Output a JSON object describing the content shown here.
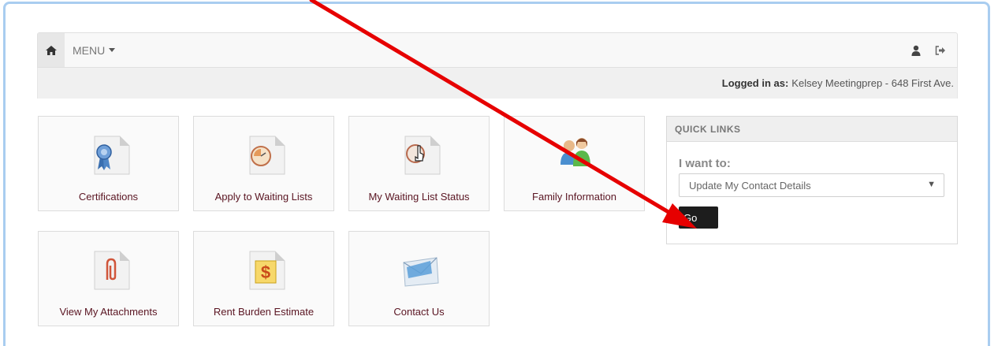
{
  "navbar": {
    "home_icon": "home-icon",
    "menu_label": "MENU",
    "user_icon": "user-icon",
    "logout_icon": "logout-icon"
  },
  "login": {
    "prefix": "Logged in as:",
    "name": "Kelsey Meetingprep - 648 First Ave."
  },
  "tiles": [
    {
      "label": "Certifications",
      "icon": "award-ribbon-icon"
    },
    {
      "label": "Apply to Waiting Lists",
      "icon": "clock-icon"
    },
    {
      "label": "My Waiting List Status",
      "icon": "status-clock-icon"
    },
    {
      "label": "Family Information",
      "icon": "family-icon"
    },
    {
      "label": "View My Attachments",
      "icon": "paperclip-icon"
    },
    {
      "label": "Rent Burden Estimate",
      "icon": "dollar-icon"
    },
    {
      "label": "Contact Us",
      "icon": "envelope-icon"
    }
  ],
  "quick_links": {
    "title": "QUICK LINKS",
    "want_label": "I want to:",
    "selected": "Update My Contact Details",
    "go_label": "Go"
  },
  "colors": {
    "frame_border": "#a9cdf0",
    "tile_text": "#5a1522",
    "annotation_arrow": "#e60000"
  }
}
